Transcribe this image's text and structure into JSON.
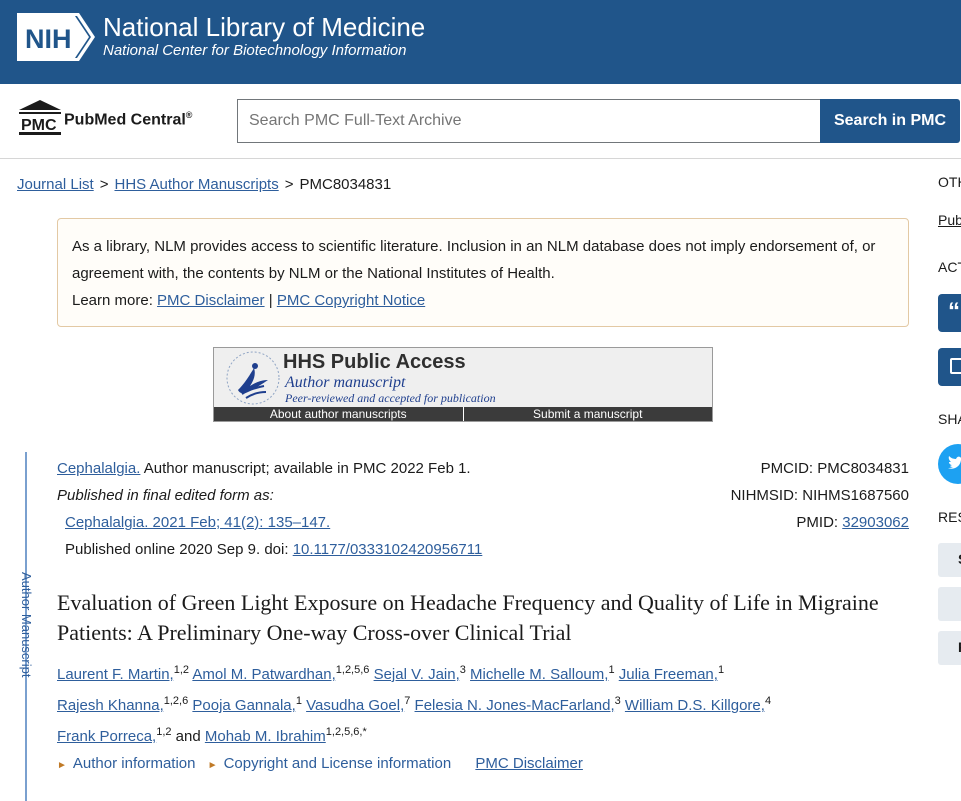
{
  "header": {
    "logo": "NIH",
    "title": "National Library of Medicine",
    "subtitle": "National Center for Biotechnology Information"
  },
  "search": {
    "logo_abbr": "PMC",
    "logo_name": "PubMed Central",
    "logo_reg": "®",
    "placeholder": "Search PMC Full-Text Archive",
    "button": "Search in PMC"
  },
  "breadcrumb": {
    "items": [
      "Journal List",
      "HHS Author Manuscripts",
      "PMC8034831"
    ],
    "separator": ">"
  },
  "disclaimer": {
    "text": "As a library, NLM provides access to scientific literature. Inclusion in an NLM database does not imply endorsement of, or agreement with, the contents by NLM or the National Institutes of Health.",
    "learn_more": "Learn more:",
    "link1": "PMC Disclaimer",
    "divider": "|",
    "link2": "PMC Copyright Notice"
  },
  "hhs": {
    "title": "HHS Public Access",
    "author_manuscript": "Author manuscript",
    "peer": "Peer-reviewed and accepted for publication",
    "about": "About author manuscripts",
    "submit": "Submit a manuscript"
  },
  "side_label": "Author Manuscript",
  "citation": {
    "journal": "Cephalalgia.",
    "status": " Author manuscript; available in PMC 2022 Feb 1.",
    "published_label": "Published in final edited form as:",
    "final_ref": "Cephalalgia. 2021 Feb; 41(2): 135–147.",
    "online": "Published online 2020 Sep 9. doi: ",
    "doi": "10.1177/0333102420956711",
    "pmcid": "PMCID: PMC8034831",
    "nihmsid": "NIHMSID: NIHMS1687560",
    "pmid_label": "PMID: ",
    "pmid": "32903062"
  },
  "article": {
    "title": "Evaluation of Green Light Exposure on Headache Frequency and Quality of Life in Migraine Patients: A Preliminary One-way Cross-over Clinical Trial",
    "authors": [
      {
        "name": "Laurent F. Martin,",
        "sup": "1,2"
      },
      {
        "name": "Amol M. Patwardhan,",
        "sup": "1,2,5,6"
      },
      {
        "name": "Sejal V. Jain,",
        "sup": "3"
      },
      {
        "name": "Michelle M. Salloum,",
        "sup": "1"
      },
      {
        "name": "Julia Freeman,",
        "sup": "1"
      },
      {
        "name": "Rajesh Khanna,",
        "sup": "1,2,6"
      },
      {
        "name": "Pooja Gannala,",
        "sup": "1"
      },
      {
        "name": "Vasudha Goel,",
        "sup": "7"
      },
      {
        "name": "Felesia N. Jones-MacFarland,",
        "sup": "3"
      },
      {
        "name": "William D.S. Killgore,",
        "sup": "4"
      },
      {
        "name": "Frank Porreca,",
        "sup": "1,2"
      },
      {
        "name": "Mohab M. Ibrahim",
        "sup": "1,2,5,6,*"
      }
    ],
    "and": "and",
    "links": {
      "author_info": "Author information",
      "copyright": "Copyright and License information",
      "disclaimer": "PMC Disclaimer"
    }
  },
  "sidebar": {
    "other": "OTH",
    "pub": "Pub",
    "actions": "ACT",
    "share": "SHA",
    "resources": "RES",
    "btn_s": "S",
    "btn_f": "F"
  }
}
